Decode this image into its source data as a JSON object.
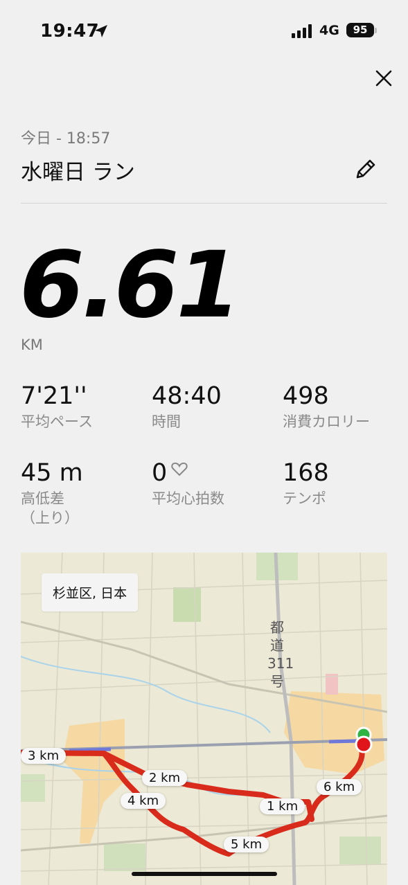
{
  "status_bar": {
    "time": "19:47",
    "network": "4G",
    "battery": "95"
  },
  "header": {
    "date": "今日 - 18:57",
    "title": "水曜日 ラン"
  },
  "distance": {
    "value": "6.61",
    "unit": "KM"
  },
  "stats": [
    {
      "value": "7'21''",
      "label": "平均ペース"
    },
    {
      "value": "48:40",
      "label": "時間"
    },
    {
      "value": "498",
      "label": "消費カロリー"
    },
    {
      "value": "45 m",
      "label": "高低差\n（上り）"
    },
    {
      "value": "0",
      "label": "平均心拍数"
    },
    {
      "value": "168",
      "label": "テンポ"
    }
  ],
  "map": {
    "location": "杉並区, 日本",
    "road_label": "都道311号",
    "km_markers": [
      "1 km",
      "2 km",
      "3 km",
      "4 km",
      "5 km",
      "6 km"
    ],
    "route_color": "#d92b1c",
    "start_color": "#2fb344",
    "end_color": "#e0141b"
  },
  "icons": {
    "close": "close-icon",
    "edit": "pencil-icon",
    "location": "location-arrow-icon",
    "signal": "signal-bars-icon",
    "heart": "heart-outline-icon"
  }
}
